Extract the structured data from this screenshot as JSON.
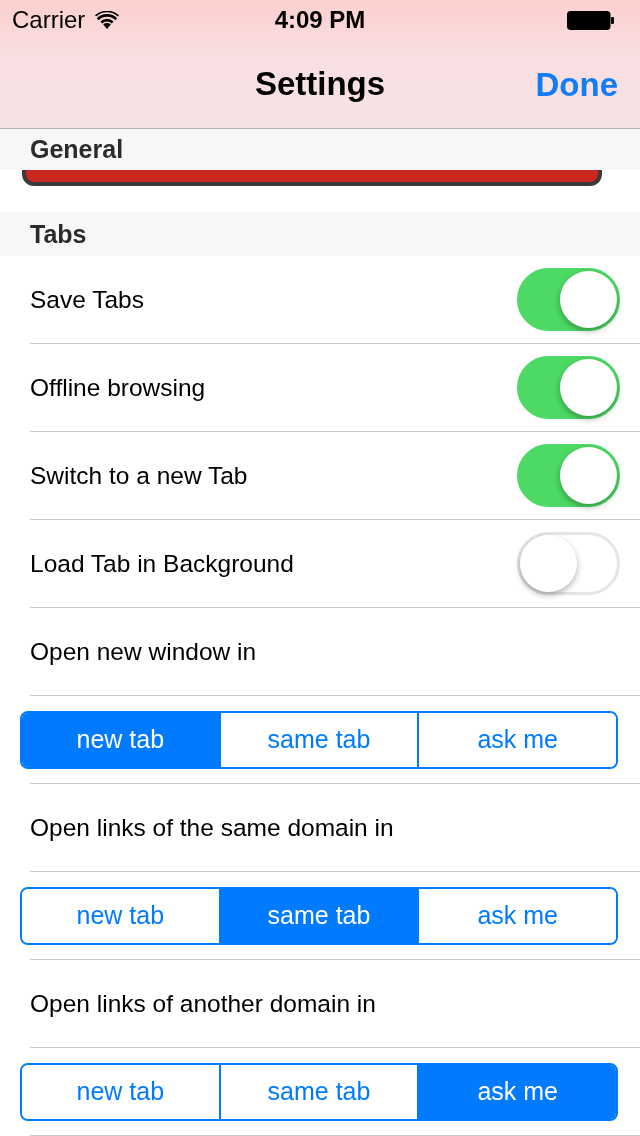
{
  "status_bar": {
    "carrier": "Carrier",
    "time": "4:09 PM"
  },
  "nav_bar": {
    "title": "Settings",
    "done": "Done"
  },
  "sections": [
    {
      "header": "General",
      "rows": [
        {
          "kind": "button-edge"
        }
      ]
    },
    {
      "header": "Tabs",
      "rows": [
        {
          "kind": "switch",
          "label": "Save Tabs",
          "on": true
        },
        {
          "kind": "switch",
          "label": "Offline browsing",
          "on": true
        },
        {
          "kind": "switch",
          "label": "Switch to a new Tab",
          "on": true
        },
        {
          "kind": "switch",
          "label": "Load Tab in Background",
          "on": false
        },
        {
          "kind": "label",
          "label": "Open new window in"
        },
        {
          "kind": "segmented",
          "segments": [
            {
              "label": "new tab",
              "selected": true
            },
            {
              "label": "same tab",
              "selected": false
            },
            {
              "label": "ask me",
              "selected": false
            }
          ]
        },
        {
          "kind": "label",
          "label": "Open links of the same domain in"
        },
        {
          "kind": "segmented",
          "segments": [
            {
              "label": "new tab",
              "selected": false
            },
            {
              "label": "same tab",
              "selected": true
            },
            {
              "label": "ask me",
              "selected": false
            }
          ]
        },
        {
          "kind": "label",
          "label": "Open links of another domain in"
        },
        {
          "kind": "segmented",
          "segments": [
            {
              "label": "new tab",
              "selected": false
            },
            {
              "label": "same tab",
              "selected": false
            },
            {
              "label": "ask me",
              "selected": true
            }
          ]
        }
      ]
    }
  ]
}
